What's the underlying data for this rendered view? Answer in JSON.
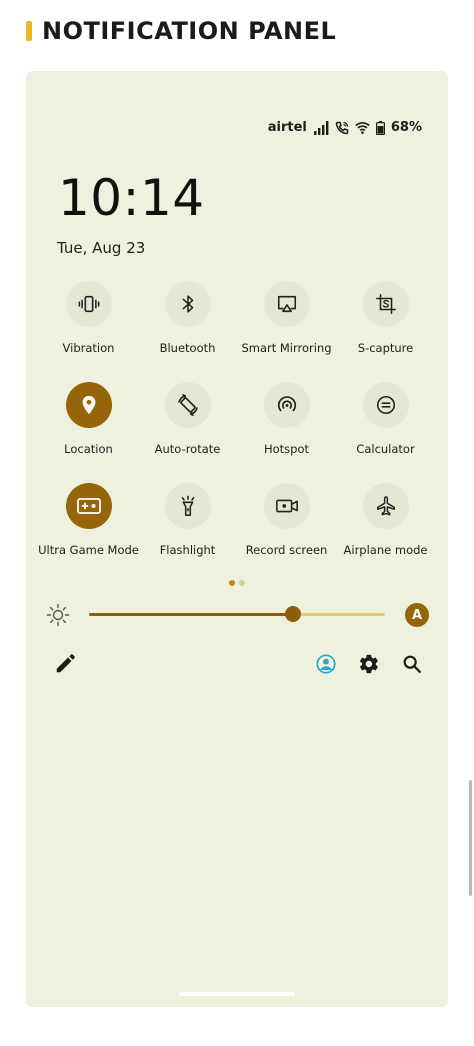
{
  "page": {
    "title": "NOTIFICATION PANEL"
  },
  "status": {
    "carrier": "airtel",
    "battery": "68%",
    "icons": [
      "signal-icon",
      "wifi-calling-icon",
      "wifi-icon",
      "battery-icon"
    ]
  },
  "clock": {
    "time": "10:14",
    "date": "Tue, Aug 23"
  },
  "tiles": [
    {
      "label": "Vibration",
      "icon": "vibration-icon",
      "active": false
    },
    {
      "label": "Bluetooth",
      "icon": "bluetooth-icon",
      "active": false
    },
    {
      "label": "Smart Mirroring",
      "icon": "smart-mirroring-icon",
      "active": false
    },
    {
      "label": "S-capture",
      "icon": "s-capture-icon",
      "active": false
    },
    {
      "label": "Location",
      "icon": "location-pin-icon",
      "active": true
    },
    {
      "label": "Auto-rotate",
      "icon": "auto-rotate-icon",
      "active": false
    },
    {
      "label": "Hotspot",
      "icon": "hotspot-icon",
      "active": false
    },
    {
      "label": "Calculator",
      "icon": "calculator-icon",
      "active": false
    },
    {
      "label": "Ultra Game Mode",
      "icon": "gamepad-icon",
      "active": true
    },
    {
      "label": "Flashlight",
      "icon": "flashlight-icon",
      "active": false
    },
    {
      "label": "Record screen",
      "icon": "record-screen-icon",
      "active": false
    },
    {
      "label": "Airplane mode",
      "icon": "airplane-icon",
      "active": false
    }
  ],
  "pager": {
    "current": 1,
    "total": 2
  },
  "brightness": {
    "level_percent": 69,
    "auto_label": "A"
  },
  "actions": [
    "edit-icon",
    "profile-icon",
    "gear-icon",
    "search-icon"
  ],
  "colors": {
    "accent": "#946609",
    "panel_bg": "#eef1dd",
    "title_bar": "#e8b91f",
    "profile": "#23a6cf"
  }
}
